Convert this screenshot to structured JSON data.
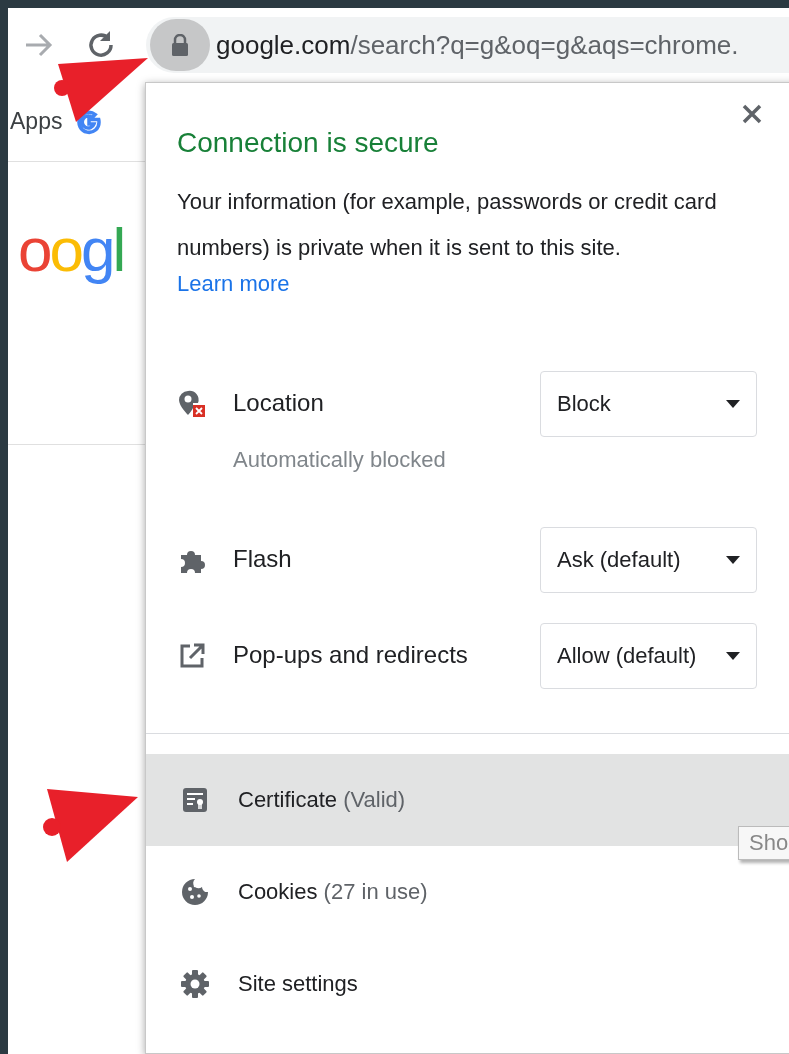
{
  "toolbar": {
    "url_host": "google.com",
    "url_path": "/search?q=g&oq=g&aqs=chrome."
  },
  "bookmarks": [
    {
      "label": "Apps"
    }
  ],
  "page": {
    "logo": "oogl"
  },
  "popup": {
    "title": "Connection is secure",
    "description": "Your information (for example, passwords or credit card numbers) is private when it is sent to this site.",
    "link": "Learn more",
    "permissions": [
      {
        "kind": "location",
        "name": "Location",
        "value": "Block",
        "note": "Automatically blocked"
      },
      {
        "kind": "flash",
        "name": "Flash",
        "value": "Ask (default)"
      },
      {
        "kind": "popups",
        "name": "Pop-ups and redirects",
        "value": "Allow (default)"
      }
    ],
    "entries": [
      {
        "kind": "certificate",
        "label": "Certificate",
        "detail": "(Valid)",
        "selected": true
      },
      {
        "kind": "cookies",
        "label": "Cookies",
        "detail": "(27 in use)",
        "selected": false
      },
      {
        "kind": "settings",
        "label": "Site settings",
        "selected": false
      }
    ]
  },
  "tooltip": "Sho"
}
